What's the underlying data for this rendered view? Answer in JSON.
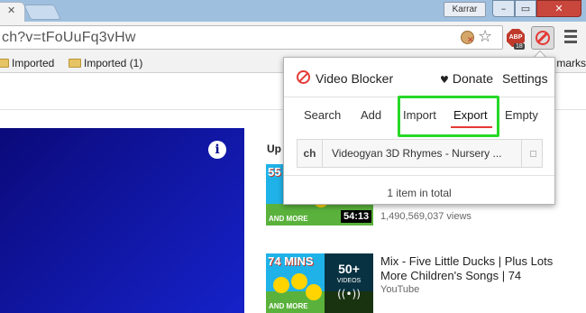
{
  "browser": {
    "profile_name": "Karrar",
    "url": "ch?v=tFoUuFq3vHw",
    "abp_label": "ABP",
    "abp_count": "18"
  },
  "bookmarks": [
    {
      "label": "Imported"
    },
    {
      "label": "Imported (1)"
    }
  ],
  "bookmarks_overflow": "marks",
  "page": {
    "up_next_heading": "Up n",
    "video1": {
      "mins": "55",
      "thumb_caption": "AND MORE",
      "duration": "54:13",
      "views": "1,490,569,037 views"
    },
    "video2": {
      "mins": "74 MINS",
      "thumb_caption": "AND MORE",
      "playlist_count": "50+",
      "playlist_label": "VIDEOS",
      "title": "Mix - Five Little Ducks | Plus Lots More Children's Songs | 74",
      "channel": "YouTube"
    }
  },
  "popup": {
    "title": "Video Blocker",
    "donate": "Donate",
    "settings": "Settings",
    "nav": {
      "search": "Search",
      "add": "Add",
      "import": "Import",
      "export": "Export",
      "empty": "Empty"
    },
    "active_tab": "Export",
    "entry": {
      "type": "ch",
      "value": "Videogyan 3D Rhymes - Nursery ..."
    },
    "total": "1 item in total"
  },
  "colors": {
    "highlight": "#27d827",
    "accent": "#e53935",
    "player": "#0b0f8f"
  },
  "icons": [
    "cookie-icon",
    "star-icon",
    "abp-icon",
    "video-blocker-icon",
    "menu-icon",
    "folder-icon",
    "info-icon",
    "heart-icon",
    "playlist-icon"
  ]
}
